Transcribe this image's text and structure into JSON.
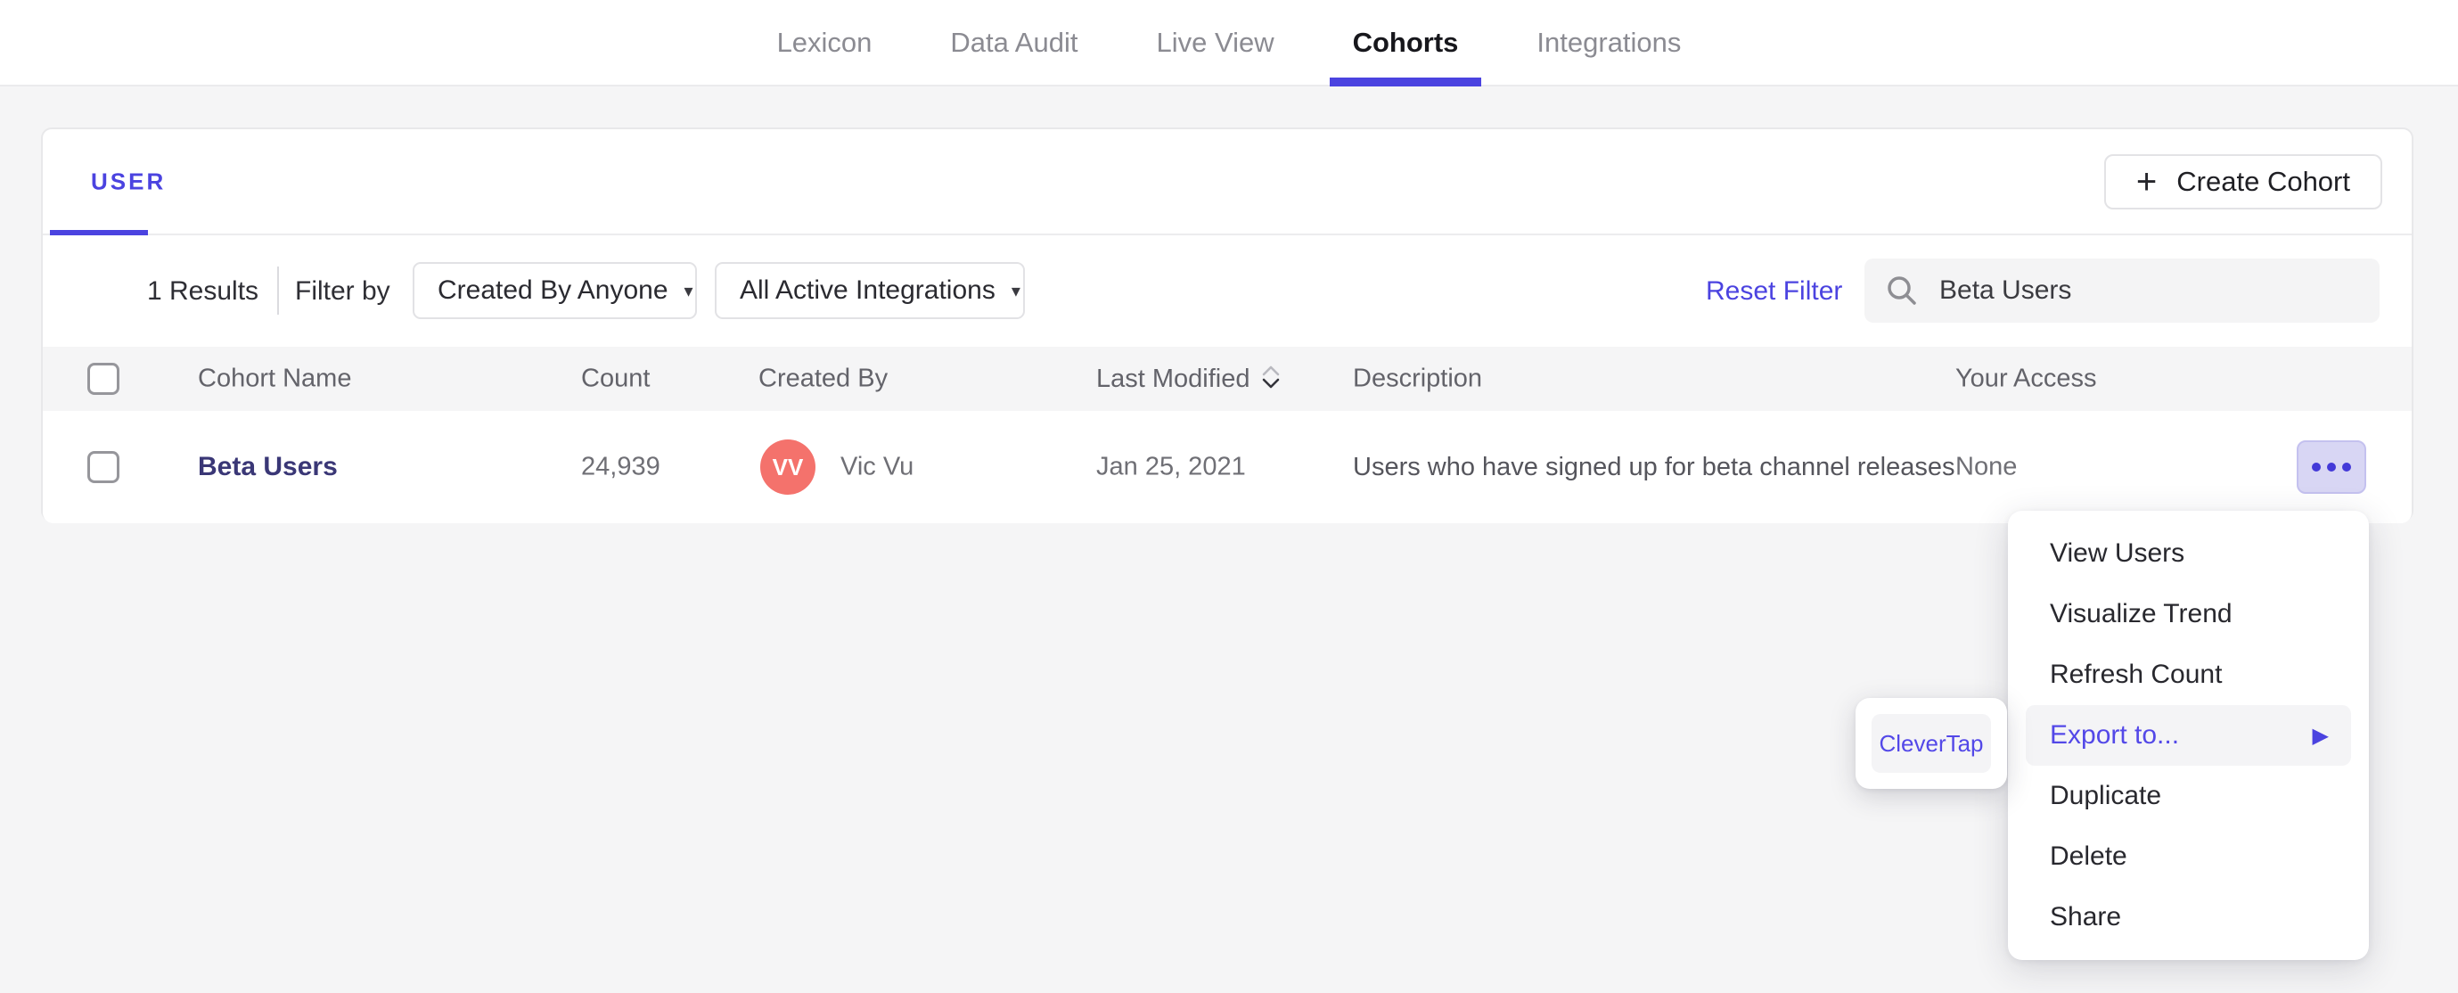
{
  "nav": {
    "items": [
      {
        "label": "Lexicon"
      },
      {
        "label": "Data Audit"
      },
      {
        "label": "Live View"
      },
      {
        "label": "Cohorts"
      },
      {
        "label": "Integrations"
      }
    ],
    "active": "Cohorts"
  },
  "tabs": {
    "user_label": "USER"
  },
  "toolbar": {
    "create_cohort_label": "Create Cohort",
    "results_count": "1 Results",
    "filter_by_label": "Filter by",
    "created_by_filter": "Created By Anyone",
    "integrations_filter": "All Active Integrations",
    "reset_filter_label": "Reset Filter",
    "search_value": "Beta Users"
  },
  "icons": {
    "plus": "+",
    "caret_down": "▾",
    "arrow_right": "▶"
  },
  "table": {
    "headers": {
      "name": "Cohort Name",
      "count": "Count",
      "created_by": "Created By",
      "last_modified": "Last Modified",
      "description": "Description",
      "your_access": "Your Access"
    },
    "row": {
      "name": "Beta Users",
      "count": "24,939",
      "avatar_initials": "VV",
      "created_by": "Vic Vu",
      "last_modified": "Jan 25, 2021",
      "description": "Users who have signed up for beta channel releases",
      "your_access": "None"
    }
  },
  "menu": {
    "items": [
      {
        "label": "View Users"
      },
      {
        "label": "Visualize Trend"
      },
      {
        "label": "Refresh Count"
      },
      {
        "label": "Export to...",
        "highlighted": true,
        "has_submenu": true
      },
      {
        "label": "Duplicate"
      },
      {
        "label": "Delete"
      },
      {
        "label": "Share"
      }
    ]
  },
  "submenu": {
    "clevertap_label": "CleverTap"
  },
  "colors": {
    "accent": "#4b43e0",
    "cohort_link": "#3a3776",
    "avatar_bg": "#f4726c",
    "menu_highlight_bg": "#f4f4f6",
    "export_text": "#5348e8",
    "page_bg": "#f5f5f6"
  }
}
